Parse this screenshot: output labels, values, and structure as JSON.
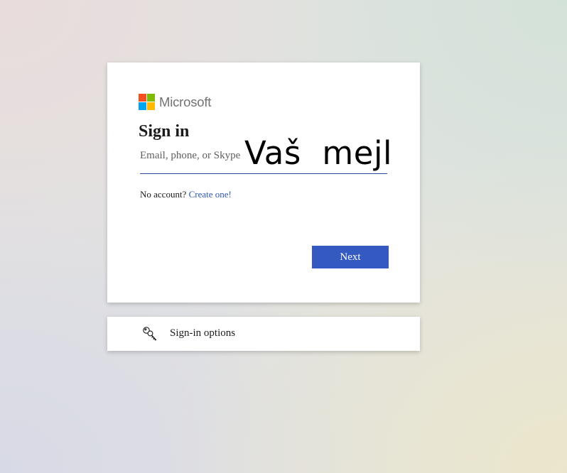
{
  "brand": {
    "name": "Microsoft",
    "colors": {
      "red": "#f25022",
      "green": "#7fba00",
      "blue": "#00a4ef",
      "yellow": "#ffb900"
    }
  },
  "signin": {
    "title": "Sign in",
    "email_placeholder": "Email, phone, or Skype",
    "email_value": "",
    "overlay_text": "Vaš  mejl",
    "no_account_text": "No account?",
    "create_link": "Create one!",
    "next_label": "Next"
  },
  "options": {
    "icon": "key-icon",
    "label": "Sign-in options"
  },
  "theme": {
    "accent": "#3459c0",
    "link": "#2b56b5"
  }
}
